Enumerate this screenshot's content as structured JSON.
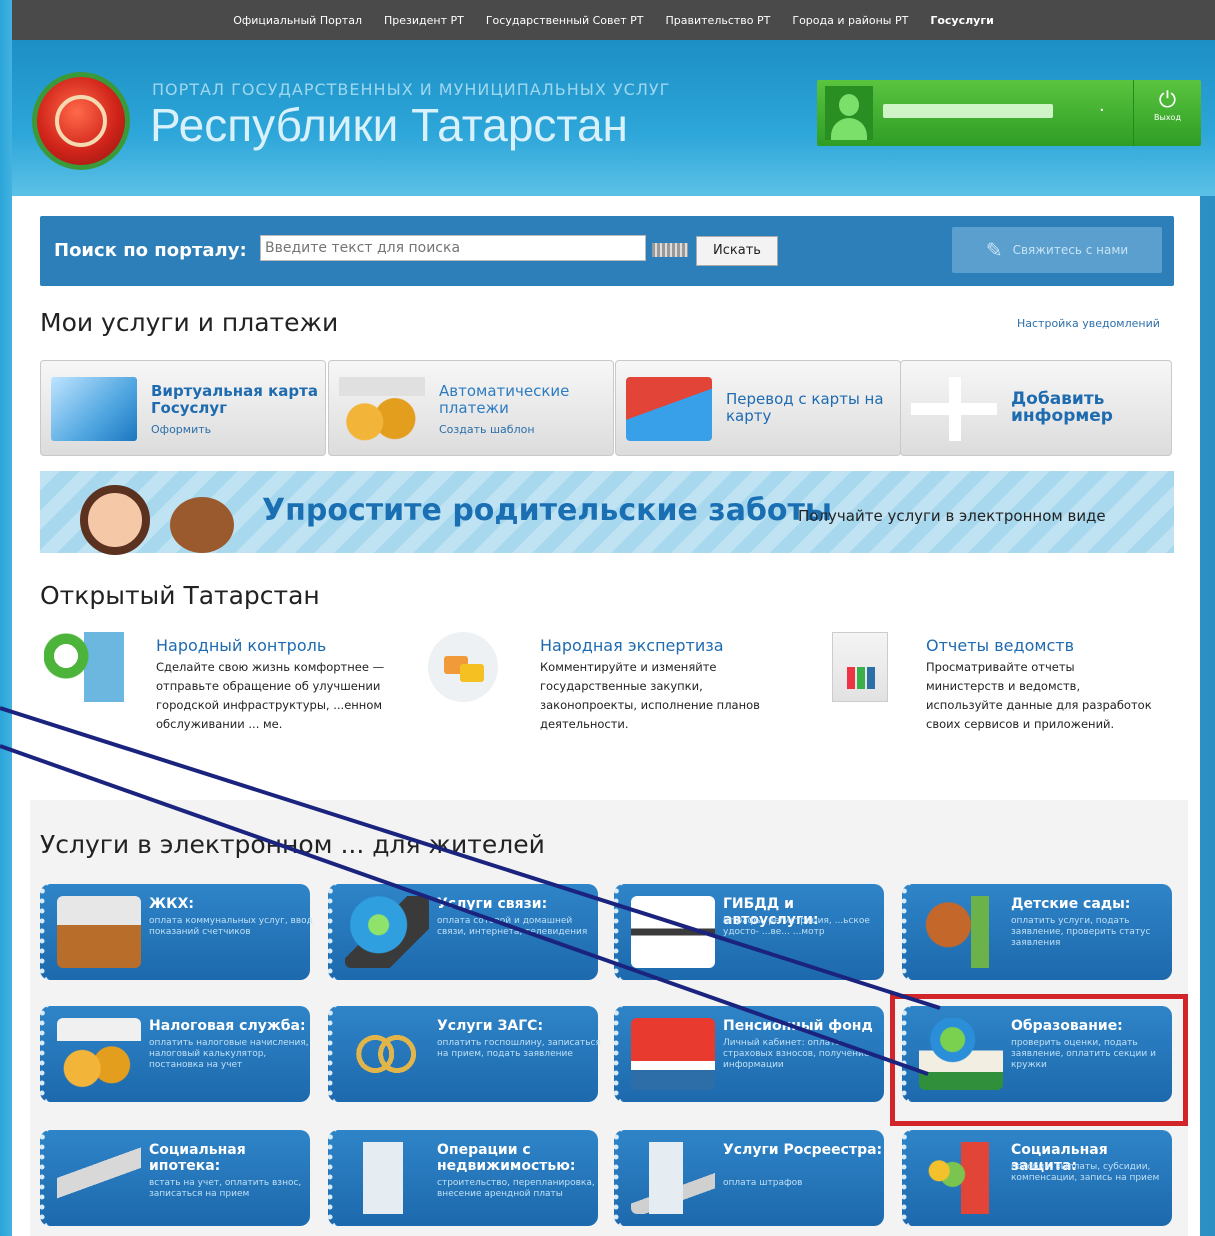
{
  "topnav": {
    "items": [
      "Официальный Портал",
      "Президент РТ",
      "Государственный Совет РТ",
      "Правительство РТ",
      "Города и районы РТ",
      "Госуслуги"
    ],
    "active_index": 5
  },
  "header": {
    "subtitle": "ПОРТАЛ ГОСУДАРСТВЕННЫХ И МУНИЦИПАЛЬНЫХ УСЛУГ",
    "title": "Республики Татарстан",
    "logout_label": "Выход"
  },
  "search": {
    "label": "Поиск по порталу:",
    "placeholder": "Введите текст для поиска",
    "button": "Искать",
    "contact": "Свяжитесь с нами"
  },
  "my_services": {
    "heading": "Мои услуги и платежи",
    "notif_link": "Настройка уведомлений",
    "tiles": [
      {
        "title": "Виртуальная карта Госуслуг",
        "sub": "Оформить",
        "icon": "card-icon"
      },
      {
        "title": "Автоматические платежи",
        "sub": "Создать шаблон",
        "icon": "calendar-coins-icon"
      },
      {
        "title": "Перевод с карты на карту",
        "sub": "",
        "icon": "cards-transfer-icon"
      },
      {
        "title": "Добавить информер",
        "sub": "",
        "icon": "plus-icon"
      }
    ]
  },
  "banner": {
    "title": "Упростите родительские заботы",
    "subtitle": "Получайте услуги в электронном виде"
  },
  "open_tatarstan": {
    "heading": "Открытый Татарстан",
    "items": [
      {
        "title": "Народный контроль",
        "desc": "Сделайте свою жизнь комфортнее — отправьте обращение об улучшении городской инфраструктуры, ...енном обслуживании ... ме."
      },
      {
        "title": "Народная экспертиза",
        "desc": "Комментируйте и изменяйте государственные закупки, законопроекты, исполнение планов деятельности."
      },
      {
        "title": "Отчеты ведомств",
        "desc": "Просматривайте отчеты министерств и ведомств, используйте данные для разработок своих сервисов и приложений."
      }
    ]
  },
  "eservices": {
    "heading": "Услуги в электронном ... для жителей",
    "items": [
      {
        "title": "ЖКХ:",
        "desc": "оплата коммунальных услуг, ввод показаний счетчиков"
      },
      {
        "title": "Услуги связи:",
        "desc": "оплата сотовой и домашней связи, интернета, телевидения"
      },
      {
        "title": "ГИБДД и автоуслуги:",
        "desc": "штрафы, регистрация, ...ьское удосто- ...ве... ...мотр"
      },
      {
        "title": "Детские сады:",
        "desc": "оплатить услуги, подать заявление, проверить статус заявления"
      },
      {
        "title": "Налоговая служба:",
        "desc": "оплатить налоговые начисления, налоговый калькулятор, постановка на учет"
      },
      {
        "title": "Услуги ЗАГС:",
        "desc": "оплатить госпошлину, записаться на прием, подать заявление"
      },
      {
        "title": "Пенсионный фонд",
        "desc": "Личный кабинет: оплата страховых взносов, получение информации"
      },
      {
        "title": "Образование:",
        "desc": "проверить оценки, подать заявление, оплатить секции и кружки"
      },
      {
        "title": "Социальная ипотека:",
        "desc": "встать на учет, оплатить взнос, записаться на прием"
      },
      {
        "title": "Операции с недвижимостью:",
        "desc": "строительство, перепланировка, внесение арендной платы"
      },
      {
        "title": "Услуги Росреестра:",
        "desc": "оплата штрафов"
      },
      {
        "title": "Социальная защита:",
        "desc": "пособия, выплаты, субсидии, компенсации, запись на прием"
      }
    ]
  },
  "colors": {
    "accent": "#2c7fb8",
    "highlight": "#d1252a",
    "user_green": "#3aa52e"
  }
}
